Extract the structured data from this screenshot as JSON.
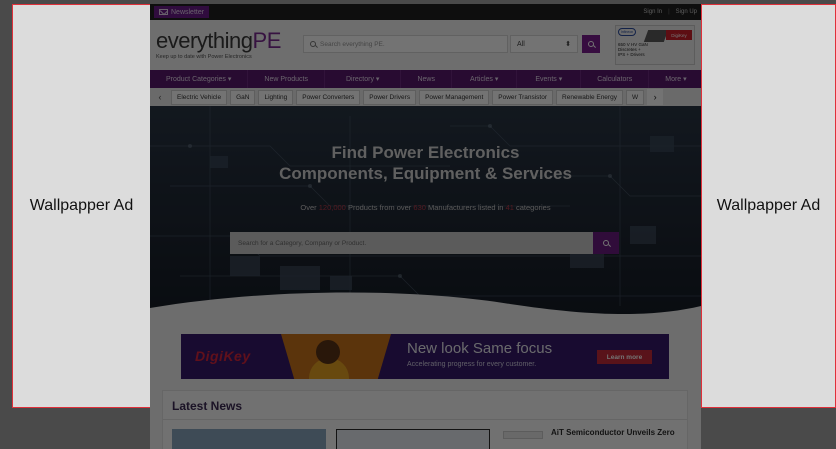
{
  "wallpaper_ads": {
    "left_label": "Wallpapper Ad",
    "right_label": "Wallpapper Ad"
  },
  "topbar": {
    "newsletter_label": "Newsletter",
    "sign_in": "Sign In",
    "separator": "|",
    "sign_up": "Sign Up"
  },
  "brand": {
    "logo_part1": "everything",
    "logo_part2": "PE",
    "tagline": "Keep up to date with Power Electronics",
    "search_placeholder": "Search everything PE.",
    "category_select_value": "All",
    "banner_ad": {
      "brand": "Infineon",
      "text_lines": [
        "650 V HV GaN",
        "Discretes +",
        "IPS + Drivers"
      ],
      "retailer": "DigiKey"
    }
  },
  "main_nav": [
    "Product Categories ▾",
    "New Products",
    "Directory ▾",
    "News",
    "Articles ▾",
    "Events ▾",
    "Calculators",
    "More ▾"
  ],
  "category_chips": [
    "Electric Vehicle",
    "GaN",
    "Lighting",
    "Power Converters",
    "Power Drivers",
    "Power Management",
    "Power Transistor",
    "Renewable Energy",
    "W"
  ],
  "hero": {
    "title_line1": "Find Power Electronics",
    "title_line2": "Components, Equipment & Services",
    "sub_prefix": "Over",
    "products_count": "120,000",
    "sub_mid": "Products from over",
    "manufacturers_count": "630",
    "sub_mid2": "Manufacturers listed in",
    "categories_count": "41",
    "sub_suffix": "categories",
    "search_placeholder": "Search for a Category, Company or Product."
  },
  "promo": {
    "brand": "DigiKey",
    "headline": "New look  Same focus",
    "subline": "Accelerating progress for every customer.",
    "cta": "Learn more"
  },
  "latest_news": {
    "title": "Latest News",
    "story_headline": "AiT Semiconductor Unveils Zero"
  },
  "colors": {
    "brand_purple": "#5a1a6d",
    "accent_purple": "#7a1e8f",
    "ad_border": "#e0303a",
    "digikey_red": "#d6243c"
  }
}
